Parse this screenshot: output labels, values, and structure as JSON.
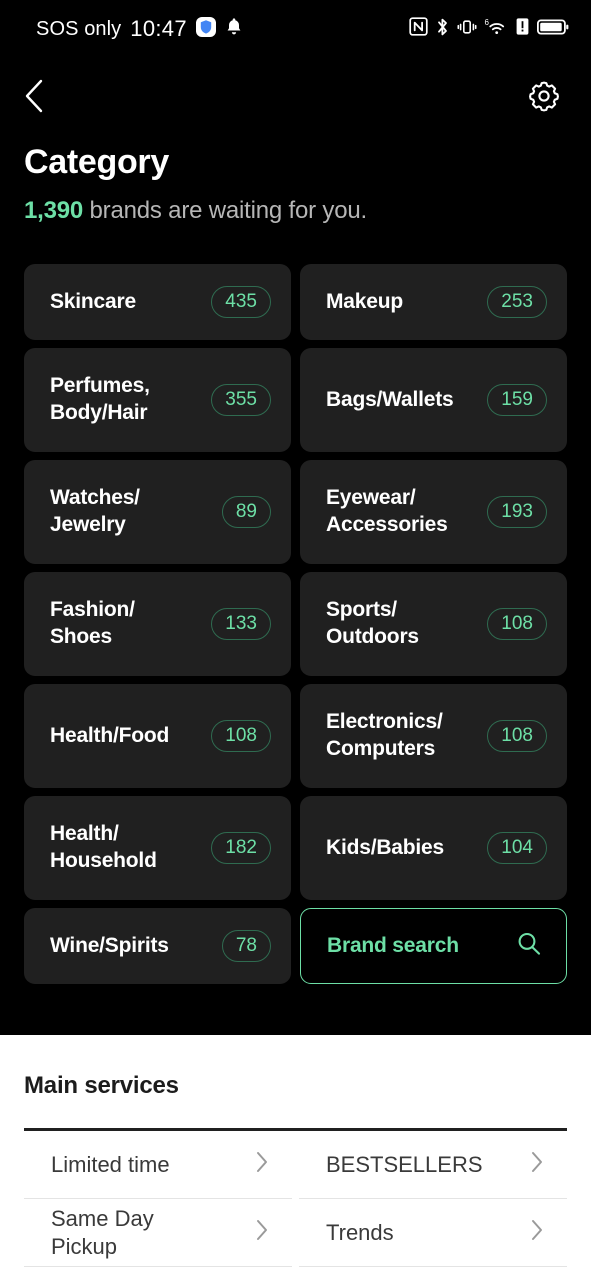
{
  "statusbar": {
    "carrier": "SOS only",
    "clock": "10:47",
    "icons_left": [
      "shield-icon",
      "bell-icon"
    ],
    "icons_right": [
      "nfc-icon",
      "bluetooth-icon",
      "vibrate-icon",
      "wifi-6-icon",
      "alert-icon",
      "battery-icon"
    ]
  },
  "navbar": {
    "back_icon": "back-chevron-icon",
    "settings_icon": "gear-icon"
  },
  "header": {
    "title": "Category",
    "count": "1,390",
    "subtitle_rest": " brands are waiting for you."
  },
  "categories": [
    {
      "label": "Skincare",
      "count": "435",
      "lines": 1
    },
    {
      "label": "Makeup",
      "count": "253",
      "lines": 1
    },
    {
      "label": "Perfumes,\nBody/Hair",
      "count": "355",
      "lines": 2
    },
    {
      "label": "Bags/Wallets",
      "count": "159",
      "lines": 2
    },
    {
      "label": "Watches/\nJewelry",
      "count": "89",
      "lines": 2
    },
    {
      "label": "Eyewear/\nAccessories",
      "count": "193",
      "lines": 2
    },
    {
      "label": "Fashion/\nShoes",
      "count": "133",
      "lines": 2
    },
    {
      "label": "Sports/\nOutdoors",
      "count": "108",
      "lines": 2
    },
    {
      "label": "Health/Food",
      "count": "108",
      "lines": 2
    },
    {
      "label": "Electronics/\nComputers",
      "count": "108",
      "lines": 2
    },
    {
      "label": "Health/\nHousehold",
      "count": "182",
      "lines": 2
    },
    {
      "label": "Kids/Babies",
      "count": "104",
      "lines": 2
    }
  ],
  "last_row": {
    "wine": {
      "label": "Wine/Spirits",
      "count": "78"
    },
    "brand_search": {
      "label": "Brand search",
      "icon": "search-icon"
    }
  },
  "main_services": {
    "title": "Main services",
    "left_items": [
      {
        "label": "Limited time"
      },
      {
        "label": "Same Day\nPickup"
      }
    ],
    "right_items": [
      {
        "label": "BESTSELLERS"
      },
      {
        "label": "Trends"
      }
    ]
  },
  "colors": {
    "accent_green": "#6ddfa6",
    "badge_border": "#2f6b50",
    "card_bg": "#202020",
    "page_bg": "#000000",
    "sheet_bg": "#ffffff",
    "subtitle_gray": "#b6b6b6"
  }
}
